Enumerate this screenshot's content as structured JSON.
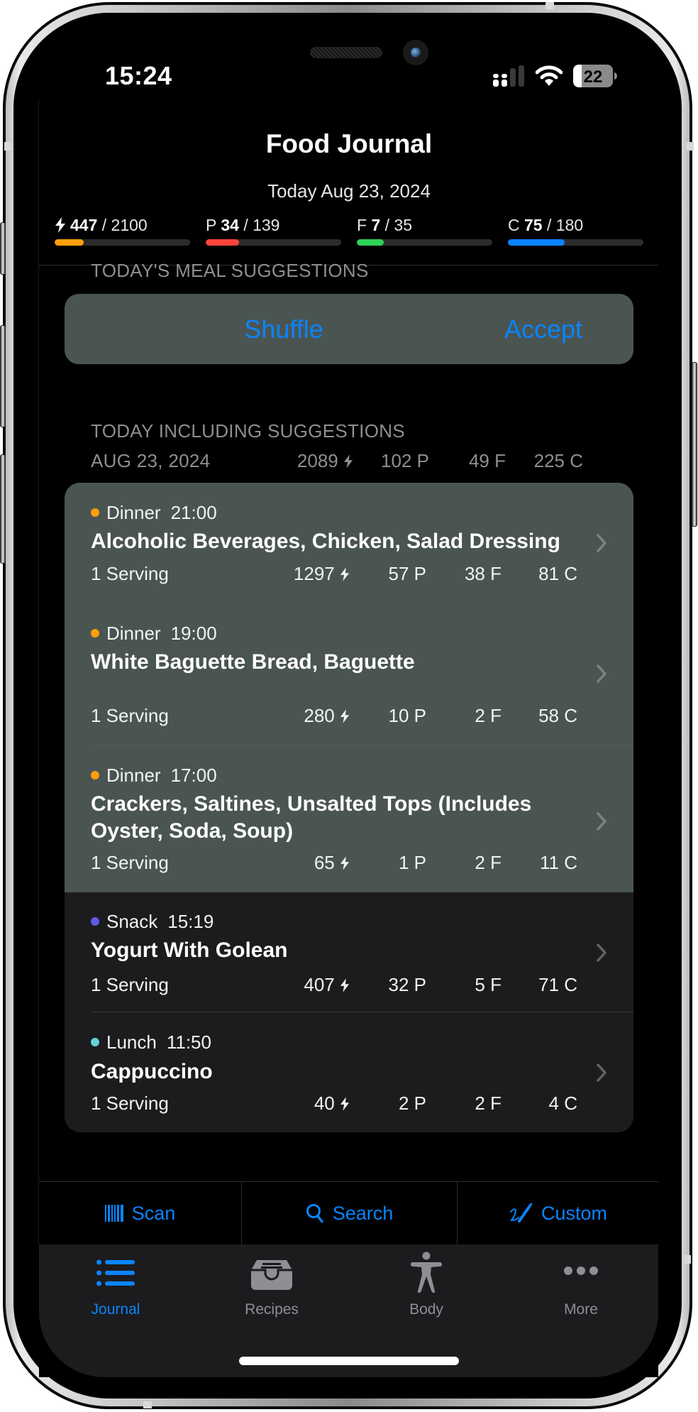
{
  "status_bar": {
    "time": "15:24",
    "battery_level": "22",
    "battery_fraction": 0.22,
    "icons": [
      "signal-icon",
      "wifi-icon",
      "battery-icon"
    ]
  },
  "header": {
    "title": "Food Journal",
    "date": "Today Aug 23, 2024"
  },
  "macros": [
    {
      "key": "energy",
      "label_icon": "bolt-icon",
      "label": "",
      "consumed": "447",
      "goal": "/ 2100",
      "fraction": 0.213,
      "color": "#ff9f0a"
    },
    {
      "key": "protein",
      "label": "P",
      "consumed": "34",
      "goal": "/ 139",
      "fraction": 0.245,
      "color": "#ff453a"
    },
    {
      "key": "fat",
      "label": "F",
      "consumed": "7",
      "goal": "/ 35",
      "fraction": 0.2,
      "color": "#30d158"
    },
    {
      "key": "carbs",
      "label": "C",
      "consumed": "75",
      "goal": "/ 180",
      "fraction": 0.417,
      "color": "#0a84ff"
    }
  ],
  "suggestions": {
    "header": "TODAY'S MEAL SUGGESTIONS",
    "shuffle_label": "Shuffle",
    "accept_label": "Accept"
  },
  "totals": {
    "header": "TODAY INCLUDING SUGGESTIONS",
    "date": "AUG 23, 2024",
    "kcal": "2089",
    "protein": "102 P",
    "fat": "49 F",
    "carbs": "225 C"
  },
  "meals": [
    {
      "type": "Dinner",
      "time": "21:00",
      "dot_color": "#ff9f0a",
      "suggested": true,
      "title": "Alcoholic Beverages, Chicken, Salad Dressing",
      "serving": "1 Serving",
      "kcal": "1297",
      "protein": "57 P",
      "fat": "38 F",
      "carbs": "81 C"
    },
    {
      "type": "Dinner",
      "time": "19:00",
      "dot_color": "#ff9f0a",
      "suggested": true,
      "title": "White Baguette Bread, Baguette",
      "serving": "1 Serving",
      "kcal": "280",
      "protein": "10 P",
      "fat": "2 F",
      "carbs": "58 C"
    },
    {
      "type": "Dinner",
      "time": "17:00",
      "dot_color": "#ff9f0a",
      "suggested": true,
      "title": "Crackers, Saltines, Unsalted Tops (Includes Oyster, Soda, Soup)",
      "serving": "1 Serving",
      "kcal": "65",
      "protein": "1 P",
      "fat": "2 F",
      "carbs": "11 C"
    },
    {
      "type": "Snack",
      "time": "15:19",
      "dot_color": "#5e5ce6",
      "suggested": false,
      "title": "Yogurt With Golean",
      "serving": "1 Serving",
      "kcal": "407",
      "protein": "32 P",
      "fat": "5 F",
      "carbs": "71 C"
    },
    {
      "type": "Lunch",
      "time": "11:50",
      "dot_color": "#64d2d8",
      "suggested": false,
      "title": "Cappuccino",
      "serving": "1 Serving",
      "kcal": "40",
      "protein": "2 P",
      "fat": "2 F",
      "carbs": "4 C"
    }
  ],
  "toolbar": {
    "scan_label": "Scan",
    "search_label": "Search",
    "custom_label": "Custom"
  },
  "tabs": [
    {
      "label": "Journal",
      "icon": "list-icon",
      "active": true
    },
    {
      "label": "Recipes",
      "icon": "tray-icon",
      "active": false
    },
    {
      "label": "Body",
      "icon": "figure-icon",
      "active": false
    },
    {
      "label": "More",
      "icon": "ellipsis-icon",
      "active": false
    }
  ],
  "colors": {
    "accent": "#0a84ff",
    "suggestion_bg": "#4a5552",
    "card_bg": "#1c1c1e",
    "secondary_text": "#8e8e93"
  }
}
